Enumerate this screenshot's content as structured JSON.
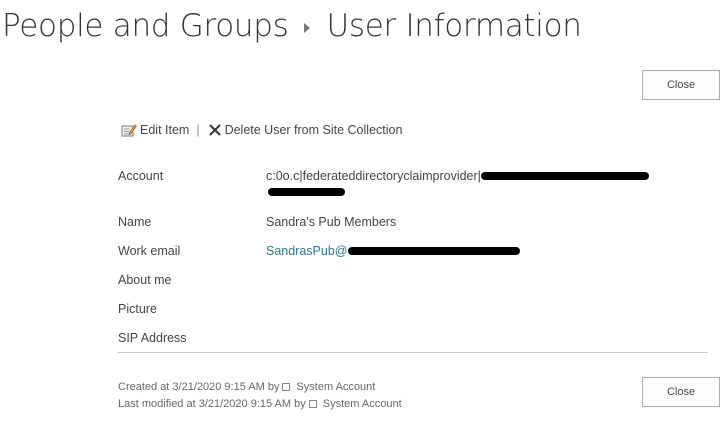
{
  "breadcrumb": {
    "parent": "People and Groups",
    "current": "User Information"
  },
  "buttons": {
    "close_top": "Close",
    "close_bottom": "Close"
  },
  "toolbar": {
    "edit_item": "Edit Item",
    "separator": "|",
    "delete_user": "Delete User from Site Collection",
    "edit_icon": "edit-item-icon",
    "delete_icon": "delete-x-icon"
  },
  "fields": {
    "account_label": "Account",
    "account_value": "c:0o.c|federateddirectoryclaimprovider|",
    "name_label": "Name",
    "name_value": "Sandra's Pub Members",
    "work_email_label": "Work email",
    "work_email_value": "SandrasPub@",
    "about_me_label": "About me",
    "picture_label": "Picture",
    "sip_address_label": "SIP Address"
  },
  "footer": {
    "created_prefix": "Created at 3/21/2020 9:15 AM by",
    "created_user": "System Account",
    "modified_prefix": "Last modified at 3/21/2020 9:15 AM by",
    "modified_user": "System Account",
    "user_icon": "user-presence-icon"
  },
  "colors": {
    "link": "#2a7a8a",
    "text": "#444444",
    "title": "#333333"
  }
}
